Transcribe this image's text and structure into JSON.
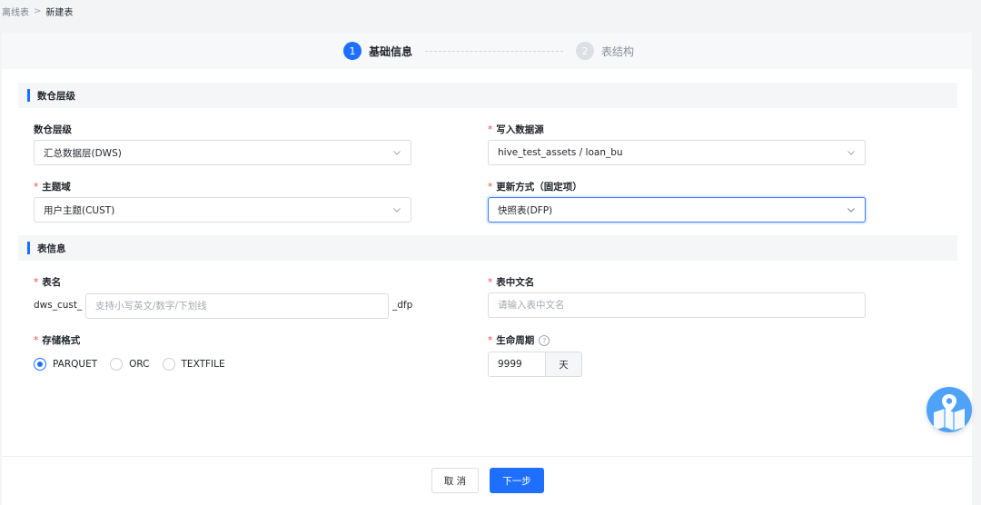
{
  "breadcrumb": {
    "parent": "离线表",
    "separator": ">",
    "current": "新建表"
  },
  "steps": [
    {
      "num": "1",
      "label": "基础信息",
      "state": "active"
    },
    {
      "num": "2",
      "label": "表结构",
      "state": "inactive"
    }
  ],
  "sections": {
    "layer": {
      "title": "数仓层级"
    },
    "table": {
      "title": "表信息"
    }
  },
  "form": {
    "layer": {
      "label": "数仓层级",
      "value": "汇总数据层(DWS)"
    },
    "datasource": {
      "required": "*",
      "label": "写入数据源",
      "value": "hive_test_assets / loan_bu"
    },
    "subject": {
      "required": "*",
      "label": "主题域",
      "value": "用户主题(CUST)"
    },
    "update_mode": {
      "required": "*",
      "label": "更新方式（固定项）",
      "value": "快照表(DFP)"
    },
    "table_name": {
      "required": "*",
      "label": "表名",
      "prefix": "dws_cust_",
      "placeholder": "支持小写英文/数字/下划线",
      "suffix": "_dfp"
    },
    "table_cn_name": {
      "required": "*",
      "label": "表中文名",
      "placeholder": "请输入表中文名"
    },
    "storage_format": {
      "required": "*",
      "label": "存储格式",
      "options": [
        "PARQUET",
        "ORC",
        "TEXTFILE"
      ],
      "selected": "PARQUET"
    },
    "lifecycle": {
      "required": "*",
      "label": "生命周期",
      "help_icon": "?",
      "value": "9999",
      "unit": "天"
    }
  },
  "footer": {
    "cancel_label": "取 消",
    "next_label": "下一步"
  },
  "colors": {
    "primary": "#1f6fff",
    "required": "#f04a3e",
    "guide": "#4ea2f7"
  },
  "icons": {
    "chevron": "chevron-down-icon",
    "help": "question-circle-icon",
    "guide": "map-guide-icon"
  }
}
